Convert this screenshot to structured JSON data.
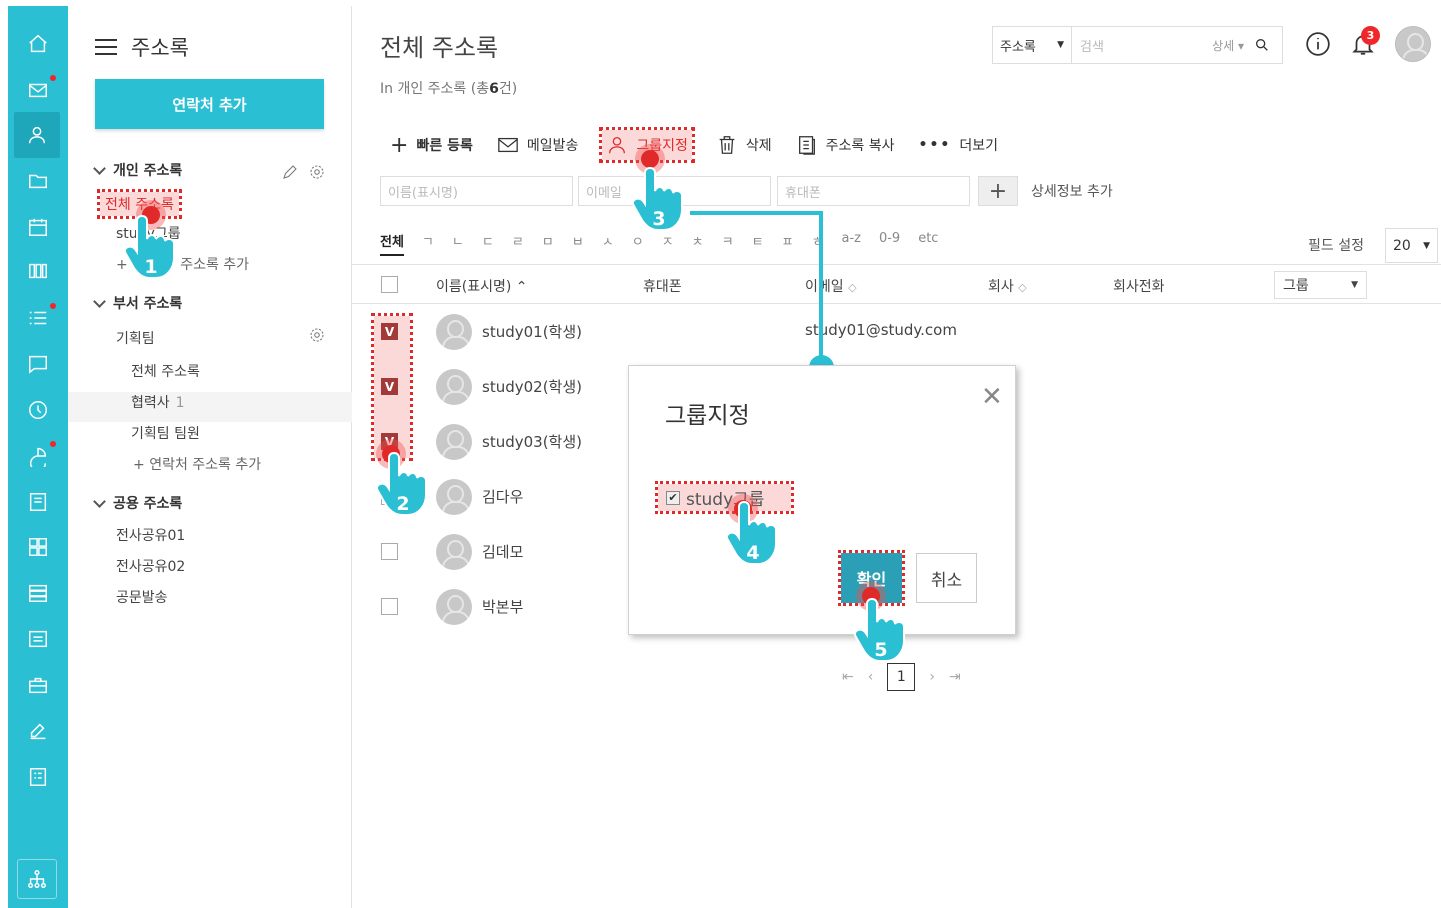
{
  "sidebar": {
    "title": "주소록",
    "add_contact": "연락처 추가",
    "personal": {
      "title": "개인 주소록",
      "items": [
        "전체 주소록",
        "study그룹"
      ],
      "add": "주소록 추가"
    },
    "dept": {
      "title": "부서 주소록",
      "team": "기획팀",
      "items": [
        "전체 주소록",
        "협력사",
        "기획팀 팀원"
      ],
      "partner_count": "1",
      "add": "연락처 주소록 추가"
    },
    "public": {
      "title": "공용 주소록",
      "items": [
        "전사공유01",
        "전사공유02",
        "공문발송"
      ]
    }
  },
  "header": {
    "title": "전체 주소록",
    "crumb_prefix": "In 개인 주소록 (총",
    "crumb_count": "6",
    "crumb_suffix": "건)",
    "search_scope": "주소록",
    "search_placeholder": "검색",
    "search_detail": "상세",
    "notif_count": "3"
  },
  "toolbar": {
    "quick_add": "빠른 등록",
    "mail": "메일발송",
    "group_assign": "그룹지정",
    "delete": "삭제",
    "copy": "주소록 복사",
    "more": "더보기"
  },
  "quick_form": {
    "name_ph": "이름(표시명)",
    "email_ph": "이메일",
    "phone_ph": "휴대폰",
    "detail": "상세정보 추가"
  },
  "alpha_filter": [
    "전체",
    "ㄱ",
    "ㄴ",
    "ㄷ",
    "ㄹ",
    "ㅁ",
    "ㅂ",
    "ㅅ",
    "ㅇ",
    "ㅈ",
    "ㅊ",
    "ㅋ",
    "ㅌ",
    "ㅍ",
    "ㅎ",
    "a-z",
    "0-9",
    "etc"
  ],
  "field_settings": "필드 설정",
  "per_page": "20",
  "table": {
    "columns": {
      "name": "이름(표시명)",
      "phone": "휴대폰",
      "email": "이메일",
      "company": "회사",
      "company_phone": "회사전화",
      "group": "그룹"
    },
    "rows": [
      {
        "name": "study01(학생)",
        "email": "study01@study.com",
        "checked": true
      },
      {
        "name": "study02(학생)",
        "email": "",
        "checked": true
      },
      {
        "name": "study03(학생)",
        "email": "",
        "checked": true
      },
      {
        "name": "김다우",
        "email": "",
        "checked": false
      },
      {
        "name": "김데모",
        "email": "",
        "checked": false
      },
      {
        "name": "박본부",
        "email": "",
        "checked": false
      }
    ]
  },
  "pager": {
    "current": "1"
  },
  "dialog": {
    "title": "그룹지정",
    "option": "study그룹",
    "ok": "확인",
    "cancel": "취소"
  },
  "steps": [
    "1",
    "2",
    "3",
    "4",
    "5"
  ],
  "colors": {
    "accent": "#2bbfd4",
    "highlight": "#e02a2a",
    "check": "#a33a3a"
  }
}
